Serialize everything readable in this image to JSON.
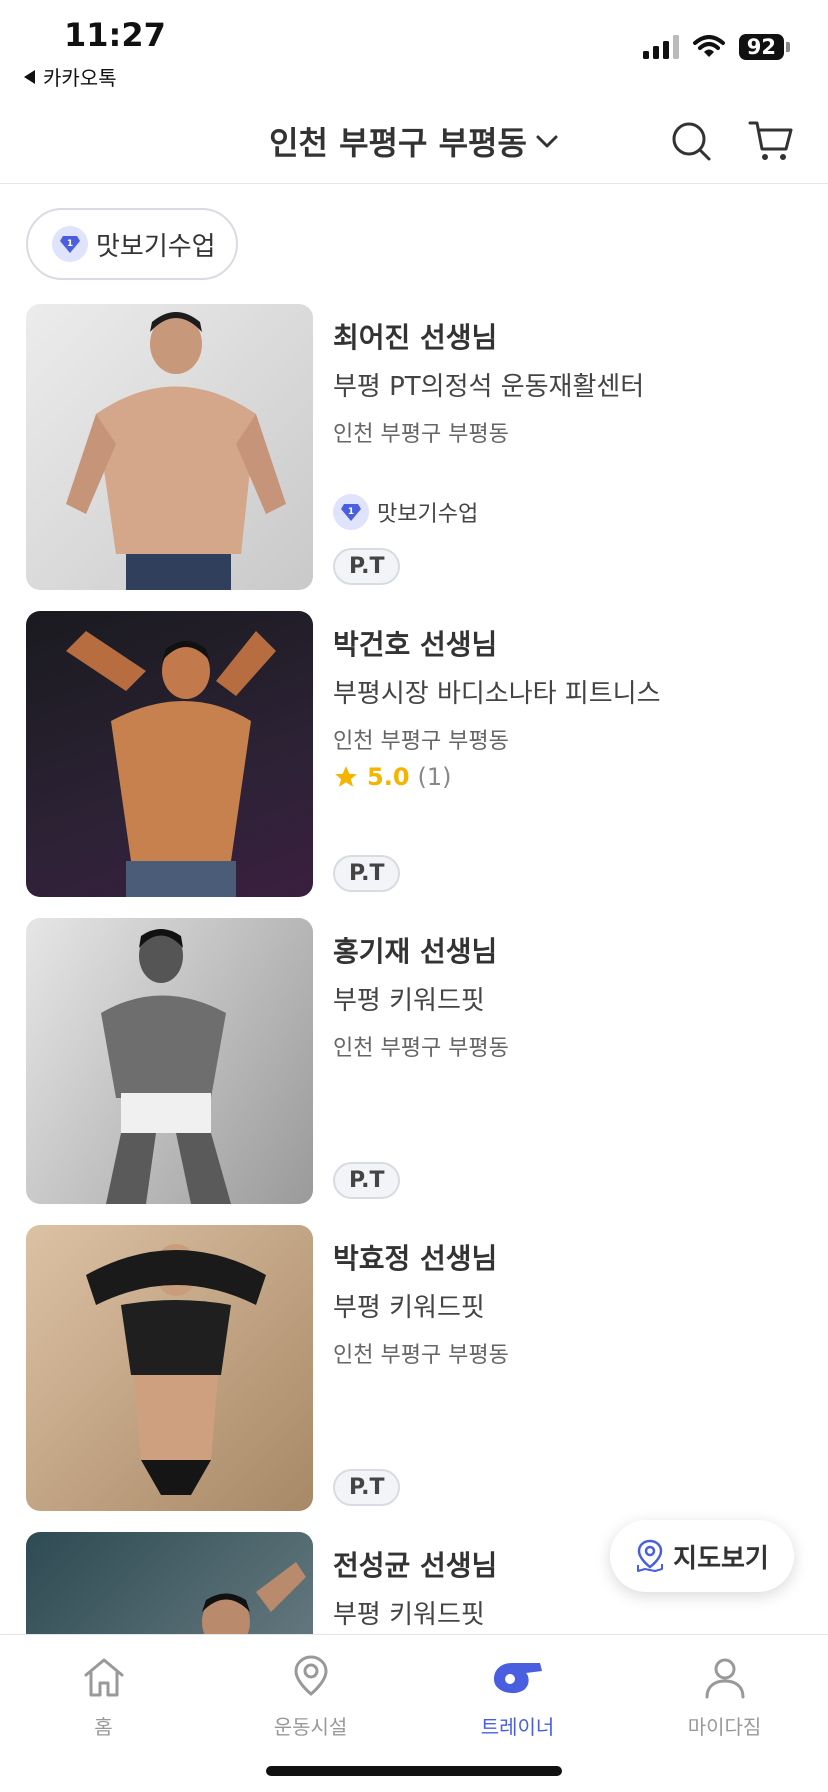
{
  "status": {
    "time": "11:27",
    "back_app": "카카오톡",
    "battery": "92"
  },
  "header": {
    "title": "인천 부평구 부평동"
  },
  "filter": {
    "chip_label": "맛보기수업"
  },
  "trainers": [
    {
      "name": "최어진 선생님",
      "gym": "부평 PT의정석 운동재활센터",
      "address": "인천 부평구 부평동",
      "trial_label": "맛보기수업",
      "badge": "P.T"
    },
    {
      "name": "박건호 선생님",
      "gym": "부평시장 바디소나타 피트니스",
      "address": "인천 부평구 부평동",
      "rating": "5.0",
      "rating_count": "(1)",
      "badge": "P.T"
    },
    {
      "name": "홍기재 선생님",
      "gym": "부평 키워드핏",
      "address": "인천 부평구 부평동",
      "badge": "P.T"
    },
    {
      "name": "박효정 선생님",
      "gym": "부평 키워드핏",
      "address": "인천 부평구 부평동",
      "badge": "P.T"
    },
    {
      "name": "전성균 선생님",
      "gym": "부평 키워드핏"
    }
  ],
  "map_button": {
    "label": "지도보기"
  },
  "tabs": [
    {
      "label": "홈",
      "icon": "home-icon"
    },
    {
      "label": "운동시설",
      "icon": "location-pin-icon"
    },
    {
      "label": "트레이너",
      "icon": "whistle-icon"
    },
    {
      "label": "마이다짐",
      "icon": "person-icon"
    }
  ],
  "colors": {
    "accent": "#4a5fe0",
    "star": "#f5b400",
    "gem_bg": "#dfe3fb"
  }
}
